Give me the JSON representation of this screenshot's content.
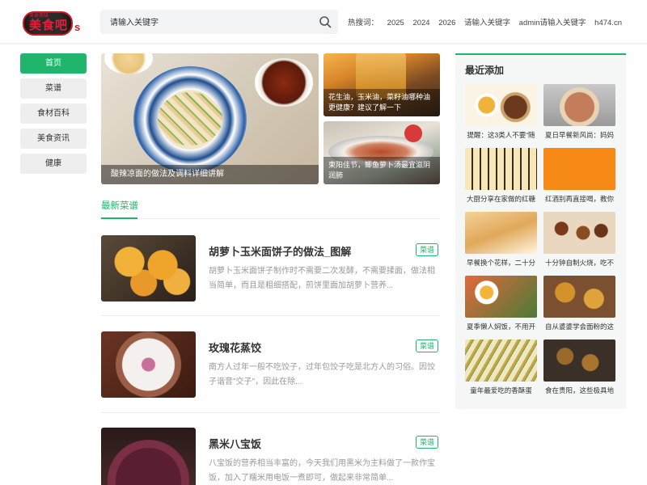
{
  "header": {
    "logo_text": "美食吧",
    "logo_tag": "美食美味",
    "logo_suffix": "s",
    "search_placeholder": "请输入关键字",
    "hot_label": "热搜词：",
    "hot_words": [
      "2025",
      "2024",
      "2026",
      "请输入关键字",
      "admin请输入关键字",
      "h474.cn"
    ]
  },
  "nav": {
    "items": [
      "首页",
      "菜谱",
      "食材百科",
      "美食资讯",
      "健康"
    ],
    "active_index": 0
  },
  "hero": {
    "main_caption": "酸辣凉面的做法及调料详细讲解",
    "side1_caption": "花生油，玉米油，菜籽油哪种油更健康？建议了解一下",
    "side2_caption": "柬阳佳节，鲫鱼萝卜汤最宜滋阴润肺"
  },
  "latest": {
    "tab_label": "最新菜谱",
    "recipes": [
      {
        "title": "胡萝卜玉米面饼子的做法_图解",
        "tag": "菜谱",
        "desc": "胡萝卜玉米面饼子制作时不需要二次发酵，不需要揉面，做法相当简单，而且是粗细搭配，煎饼里面加胡萝卜营养..."
      },
      {
        "title": "玫瑰花蒸饺",
        "tag": "菜谱",
        "desc": "南方人过年一般不吃饺子，过年包饺子吃是北方人的习俗。因饺子谐音\"交子\"，因此在除..."
      },
      {
        "title": "黑米八宝饭",
        "tag": "菜谱",
        "desc": "八宝饭的营养相当丰富的，今天我们用黑米为主料做了一款作宝饭，加入了糯米用电饭一煮即可，做起来非常简单..."
      }
    ]
  },
  "sidebar": {
    "title": "最近添加",
    "items": [
      {
        "caption": "提醒：这3类人不要“随"
      },
      {
        "caption": "夏日早餐新风尚：妈妈"
      },
      {
        "caption": "大厨分享在家做的红糖"
      },
      {
        "caption": "红酒别再直接喝，教你"
      },
      {
        "caption": "早餐换个花样，二十分"
      },
      {
        "caption": "十分钟自制火烧，吃不"
      },
      {
        "caption": "夏季懒人焖饭，不用开"
      },
      {
        "caption": "自从婆婆学会面粉的这"
      },
      {
        "caption": "童年最爱吃的香酥蛋"
      },
      {
        "caption": "食在贵阳，这些极具地"
      }
    ]
  }
}
